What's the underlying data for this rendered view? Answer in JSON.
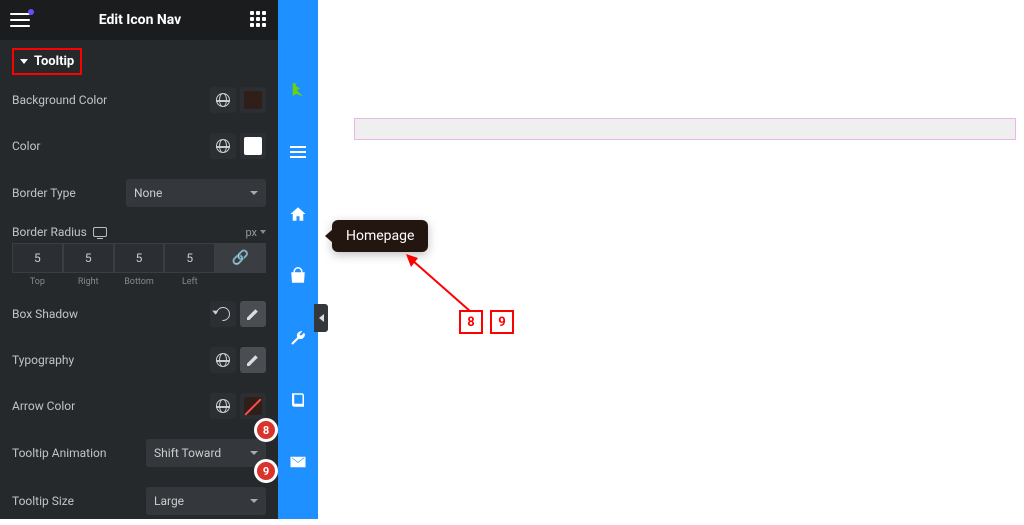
{
  "header": {
    "title": "Edit Icon Nav"
  },
  "section": {
    "title": "Tooltip"
  },
  "fields": {
    "bgcolor": {
      "label": "Background Color",
      "value": "#301f18"
    },
    "color": {
      "label": "Color",
      "value": "#ffffff"
    },
    "borderType": {
      "label": "Border Type",
      "value": "None"
    },
    "borderRadius": {
      "label": "Border Radius",
      "unit": "px",
      "values": {
        "top": "5",
        "right": "5",
        "bottom": "5",
        "left": "5"
      },
      "labels": {
        "top": "Top",
        "right": "Right",
        "bottom": "Bottom",
        "left": "Left"
      }
    },
    "boxShadow": {
      "label": "Box Shadow"
    },
    "typography": {
      "label": "Typography"
    },
    "arrowColor": {
      "label": "Arrow Color",
      "value": "#301f18"
    },
    "tooltipAnim": {
      "label": "Tooltip Animation",
      "value": "Shift Toward"
    },
    "tooltipSize": {
      "label": "Tooltip Size",
      "value": "Large"
    }
  },
  "iconbar": {
    "items": [
      {
        "name": "brand",
        "icon": "brand-icon"
      },
      {
        "name": "menu",
        "icon": "hamburger-icon"
      },
      {
        "name": "home",
        "icon": "home-icon",
        "tooltip": "Homepage"
      },
      {
        "name": "shop",
        "icon": "bag-icon"
      },
      {
        "name": "tools",
        "icon": "wrench-icon"
      },
      {
        "name": "docs",
        "icon": "book-icon"
      },
      {
        "name": "contact",
        "icon": "mail-icon"
      }
    ]
  },
  "tooltip_preview": "Homepage",
  "callouts": {
    "panel8": "8",
    "panel9": "9",
    "canvas8": "8",
    "canvas9": "9"
  }
}
